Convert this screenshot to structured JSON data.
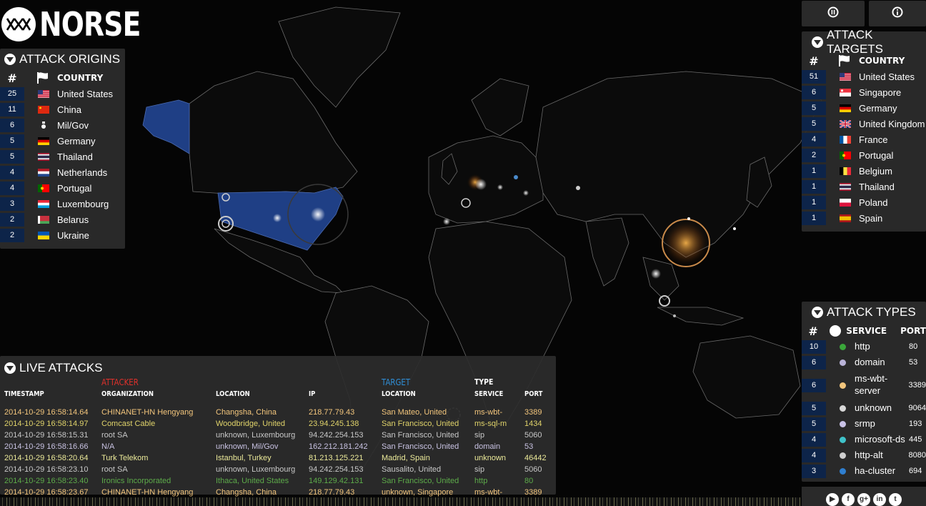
{
  "brand": {
    "name": "NORSE"
  },
  "controls": {
    "pause_icon": "pause-icon",
    "info_icon": "info-icon"
  },
  "origins": {
    "title": "ATTACK ORIGINS",
    "col_country": "COUNTRY",
    "items": [
      {
        "count": "25",
        "country": "United States",
        "flag": "us"
      },
      {
        "count": "11",
        "country": "China",
        "flag": "cn"
      },
      {
        "count": "6",
        "country": "Mil/Gov",
        "flag": "mil"
      },
      {
        "count": "5",
        "country": "Germany",
        "flag": "de"
      },
      {
        "count": "5",
        "country": "Thailand",
        "flag": "th"
      },
      {
        "count": "4",
        "country": "Netherlands",
        "flag": "nl"
      },
      {
        "count": "4",
        "country": "Portugal",
        "flag": "pt"
      },
      {
        "count": "3",
        "country": "Luxembourg",
        "flag": "lu"
      },
      {
        "count": "2",
        "country": "Belarus",
        "flag": "by"
      },
      {
        "count": "2",
        "country": "Ukraine",
        "flag": "ua"
      }
    ]
  },
  "targets": {
    "title": "ATTACK TARGETS",
    "col_country": "COUNTRY",
    "items": [
      {
        "count": "51",
        "country": "United States",
        "flag": "us"
      },
      {
        "count": "6",
        "country": "Singapore",
        "flag": "sg"
      },
      {
        "count": "5",
        "country": "Germany",
        "flag": "de"
      },
      {
        "count": "5",
        "country": "United Kingdom",
        "flag": "gb"
      },
      {
        "count": "4",
        "country": "France",
        "flag": "fr"
      },
      {
        "count": "2",
        "country": "Portugal",
        "flag": "pt"
      },
      {
        "count": "1",
        "country": "Belgium",
        "flag": "be"
      },
      {
        "count": "1",
        "country": "Thailand",
        "flag": "th"
      },
      {
        "count": "1",
        "country": "Poland",
        "flag": "pl"
      },
      {
        "count": "1",
        "country": "Spain",
        "flag": "es"
      }
    ]
  },
  "types": {
    "title": "ATTACK TYPES",
    "col_service": "SERVICE",
    "col_port": "PORT",
    "items": [
      {
        "count": "10",
        "service": "http",
        "port": "80",
        "color": "#3aa63a"
      },
      {
        "count": "6",
        "service": "domain",
        "port": "53",
        "color": "#b9b3d8"
      },
      {
        "count": "6",
        "service": "ms-wbt-server",
        "port": "3389",
        "color": "#f2c57c"
      },
      {
        "count": "5",
        "service": "unknown",
        "port": "9064",
        "color": "#d8d8d8"
      },
      {
        "count": "5",
        "service": "srmp",
        "port": "193",
        "color": "#c9c2e6"
      },
      {
        "count": "4",
        "service": "microsoft-ds",
        "port": "445",
        "color": "#3fc2c9"
      },
      {
        "count": "4",
        "service": "http-alt",
        "port": "8080",
        "color": "#cfcfcf"
      },
      {
        "count": "3",
        "service": "ha-cluster",
        "port": "694",
        "color": "#2f7fd0"
      }
    ]
  },
  "live": {
    "title": "LIVE ATTACKS",
    "attacker_label": "ATTACKER",
    "target_label": "TARGET",
    "type_label": "TYPE",
    "heads": {
      "timestamp": "TIMESTAMP",
      "organization": "ORGANIZATION",
      "location": "LOCATION",
      "ip": "IP",
      "target_location": "LOCATION",
      "service": "SERVICE",
      "port": "PORT"
    },
    "rows": [
      {
        "ts": "2014-10-29 16:58:14.64",
        "org": "CHINANET-HN Hengyang",
        "loc": "Changsha, China",
        "ip": "218.77.79.43",
        "tloc": "San Mateo, United",
        "svc": "ms-wbt-",
        "port": "3389",
        "color": "#f2c57c"
      },
      {
        "ts": "2014-10-29 16:58:14.97",
        "org": "Comcast Cable",
        "loc": "Woodbridge, United",
        "ip": "23.94.245.138",
        "tloc": "San Francisco, United",
        "svc": "ms-sql-m",
        "port": "1434",
        "color": "#e0d36a"
      },
      {
        "ts": "2014-10-29 16:58:15.31",
        "org": "root SA",
        "loc": "unknown, Luxembourg",
        "ip": "94.242.254.153",
        "tloc": "San Francisco, United",
        "svc": "sip",
        "port": "5060",
        "color": "#c8c8c8"
      },
      {
        "ts": "2014-10-29 16:58:16.66",
        "org": "N/A",
        "loc": "unknown, Mil/Gov",
        "ip": "162.212.181.242",
        "tloc": "San Francisco, United",
        "svc": "domain",
        "port": "53",
        "color": "#c9c3e3"
      },
      {
        "ts": "2014-10-29 16:58:20.64",
        "org": "Turk Telekom",
        "loc": "Istanbul, Turkey",
        "ip": "81.213.125.221",
        "tloc": "Madrid, Spain",
        "svc": "unknown",
        "port": "46442",
        "color": "#ecea9a"
      },
      {
        "ts": "2014-10-29 16:58:23.10",
        "org": "root SA",
        "loc": "unknown, Luxembourg",
        "ip": "94.242.254.153",
        "tloc": "Sausalito, United",
        "svc": "sip",
        "port": "5060",
        "color": "#c8c8c8"
      },
      {
        "ts": "2014-10-29 16:58:23.40",
        "org": "Ironics Incorporated",
        "loc": "Ithaca, United States",
        "ip": "149.129.42.131",
        "tloc": "San Francisco, United",
        "svc": "http",
        "port": "80",
        "color": "#5dab4a"
      },
      {
        "ts": "2014-10-29 16:58:23.67",
        "org": "CHINANET-HN Hengyang",
        "loc": "Changsha, China",
        "ip": "218.77.79.43",
        "tloc": "unknown, Singapore",
        "svc": "ms-wbt-",
        "port": "3389",
        "color": "#f2c57c"
      }
    ]
  },
  "colors": {
    "panel_bg": "#2c2c2c",
    "rank_bg": "#0d2449",
    "attacker_red": "#e0312b",
    "target_blue": "#2f8fd8",
    "highlight_usa": "#1f3f85"
  },
  "social_icons": [
    "youtube-icon",
    "facebook-icon",
    "google-plus-icon",
    "linkedin-icon",
    "twitter-icon"
  ]
}
